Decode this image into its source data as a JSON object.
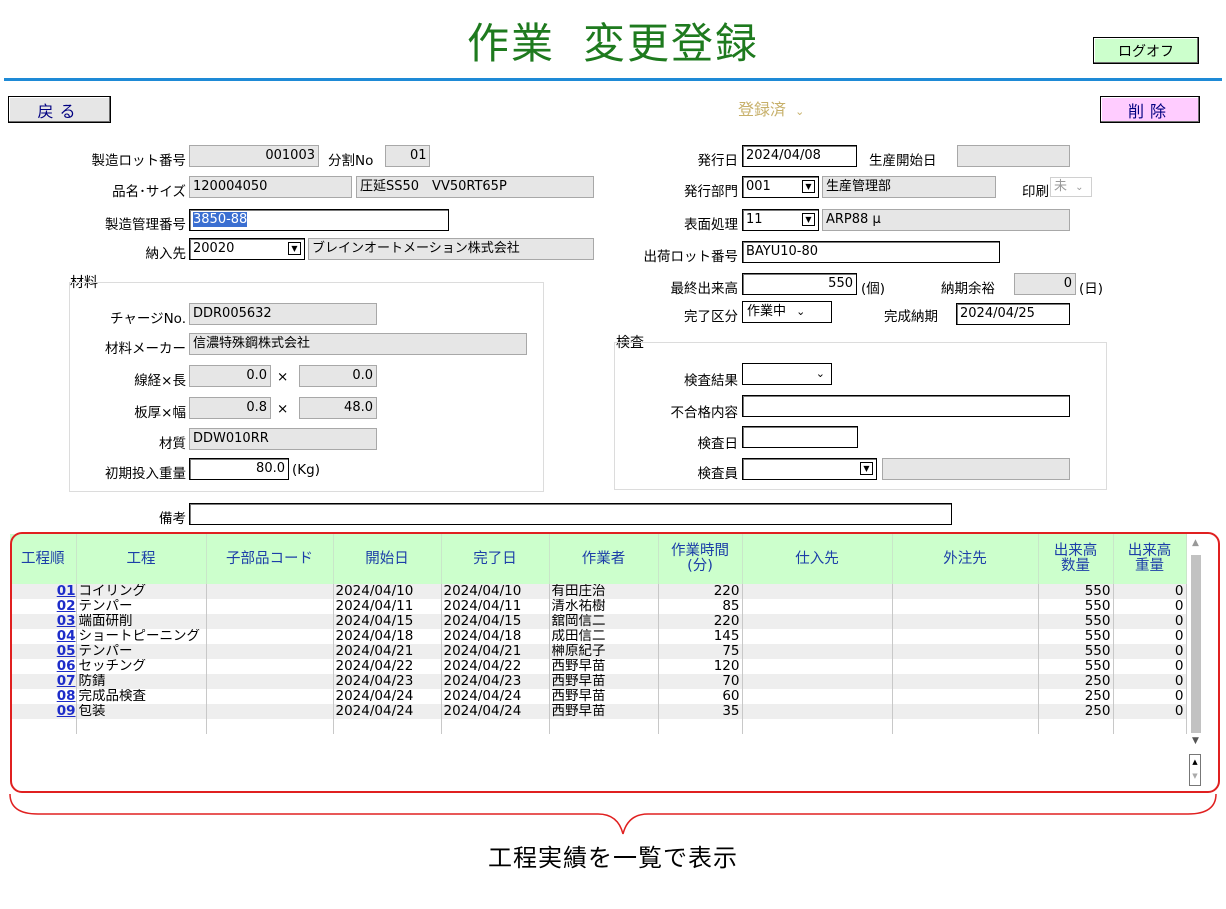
{
  "header": {
    "title_main": "作業",
    "title_sub": "変更登録",
    "logoff_label": "ログオフ",
    "back_label": "戻る",
    "delete_label": "削除",
    "status_value": "登録済"
  },
  "form": {
    "lot_label": "製造ロット番号",
    "lot_value": "001003",
    "split_label": "分割No",
    "split_value": "01",
    "item_label": "品名･サイズ",
    "item_code": "120004050",
    "item_name": "圧延SS50　VV50RT65P",
    "mgmt_label": "製造管理番号",
    "mgmt_value": "3850-88",
    "delivery_label": "納入先",
    "delivery_code": "20020",
    "delivery_name": "ブレインオートメーション株式会社",
    "issue_date_label": "発行日",
    "issue_date_value": "2024/04/08",
    "prod_start_label": "生産開始日",
    "prod_start_value": "",
    "issue_dept_label": "発行部門",
    "issue_dept_code": "001",
    "issue_dept_name": "生産管理部",
    "print_label": "印刷",
    "print_value": "未",
    "surface_label": "表面処理",
    "surface_code": "11",
    "surface_name": "ARP88 μ",
    "ship_lot_label": "出荷ロット番号",
    "ship_lot_value": "BAYU10-80",
    "final_qty_label": "最終出来高",
    "final_qty_value": "550",
    "final_qty_unit": "(個)",
    "margin_label": "納期余裕",
    "margin_value": "0",
    "margin_unit": "(日)",
    "done_kind_label": "完了区分",
    "done_kind_value": "作業中",
    "done_date_label": "完成納期",
    "done_date_value": "2024/04/25",
    "remarks_label": "備考",
    "remarks_value": ""
  },
  "material": {
    "group_label": "材料",
    "charge_label": "チャージNo.",
    "charge_value": "DDR005632",
    "maker_label": "材料メーカー",
    "maker_value": "信濃特殊鋼株式会社",
    "wire_label": "線経×長",
    "wire_d": "0.0",
    "wire_l": "0.0",
    "times": "×",
    "plate_label": "板厚×幅",
    "plate_t": "0.8",
    "plate_w": "48.0",
    "quality_label": "材質",
    "quality_value": "DDW010RR",
    "init_weight_label": "初期投入重量",
    "init_weight_value": "80.0",
    "init_weight_unit": "(Kg)"
  },
  "inspection": {
    "group_label": "検査",
    "result_label": "検査結果",
    "result_value": "",
    "defect_label": "不合格内容",
    "defect_value": "",
    "date_label": "検査日",
    "date_value": "",
    "inspector_label": "検査員",
    "inspector_value": "",
    "inspector_name": ""
  },
  "grid": {
    "headers": [
      "工程順",
      "工程",
      "子部品コード",
      "開始日",
      "完了日",
      "作業者",
      "作業時間\n(分)",
      "仕入先",
      "外注先",
      "出来高\n数量",
      "出来高\n重量"
    ],
    "rows": [
      {
        "no": "01",
        "proc": "コイリング",
        "part": "",
        "start": "2024/04/10",
        "end": "2024/04/10",
        "worker": "有田庄治",
        "time": "220",
        "supplier": "",
        "outsource": "",
        "qty": "550",
        "weight": "0"
      },
      {
        "no": "02",
        "proc": "テンパー",
        "part": "",
        "start": "2024/04/11",
        "end": "2024/04/11",
        "worker": "清水祐樹",
        "time": "85",
        "supplier": "",
        "outsource": "",
        "qty": "550",
        "weight": "0"
      },
      {
        "no": "03",
        "proc": "端面研削",
        "part": "",
        "start": "2024/04/15",
        "end": "2024/04/15",
        "worker": "舘岡信二",
        "time": "220",
        "supplier": "",
        "outsource": "",
        "qty": "550",
        "weight": "0"
      },
      {
        "no": "04",
        "proc": "ショートピーニング",
        "part": "",
        "start": "2024/04/18",
        "end": "2024/04/18",
        "worker": "成田信二",
        "time": "145",
        "supplier": "",
        "outsource": "",
        "qty": "550",
        "weight": "0"
      },
      {
        "no": "05",
        "proc": "テンパー",
        "part": "",
        "start": "2024/04/21",
        "end": "2024/04/21",
        "worker": "榊原紀子",
        "time": "75",
        "supplier": "",
        "outsource": "",
        "qty": "550",
        "weight": "0"
      },
      {
        "no": "06",
        "proc": "セッチング",
        "part": "",
        "start": "2024/04/22",
        "end": "2024/04/22",
        "worker": "西野早苗",
        "time": "120",
        "supplier": "",
        "outsource": "",
        "qty": "550",
        "weight": "0"
      },
      {
        "no": "07",
        "proc": "防錆",
        "part": "",
        "start": "2024/04/23",
        "end": "2024/04/23",
        "worker": "西野早苗",
        "time": "70",
        "supplier": "",
        "outsource": "",
        "qty": "250",
        "weight": "0"
      },
      {
        "no": "08",
        "proc": "完成品検査",
        "part": "",
        "start": "2024/04/24",
        "end": "2024/04/24",
        "worker": "西野早苗",
        "time": "60",
        "supplier": "",
        "outsource": "",
        "qty": "250",
        "weight": "0"
      },
      {
        "no": "09",
        "proc": "包装",
        "part": "",
        "start": "2024/04/24",
        "end": "2024/04/24",
        "worker": "西野早苗",
        "time": "35",
        "supplier": "",
        "outsource": "",
        "qty": "250",
        "weight": "0"
      }
    ]
  },
  "annotation": {
    "caption": "工程実績を一覧で表示",
    "box_color": "#e02020"
  }
}
